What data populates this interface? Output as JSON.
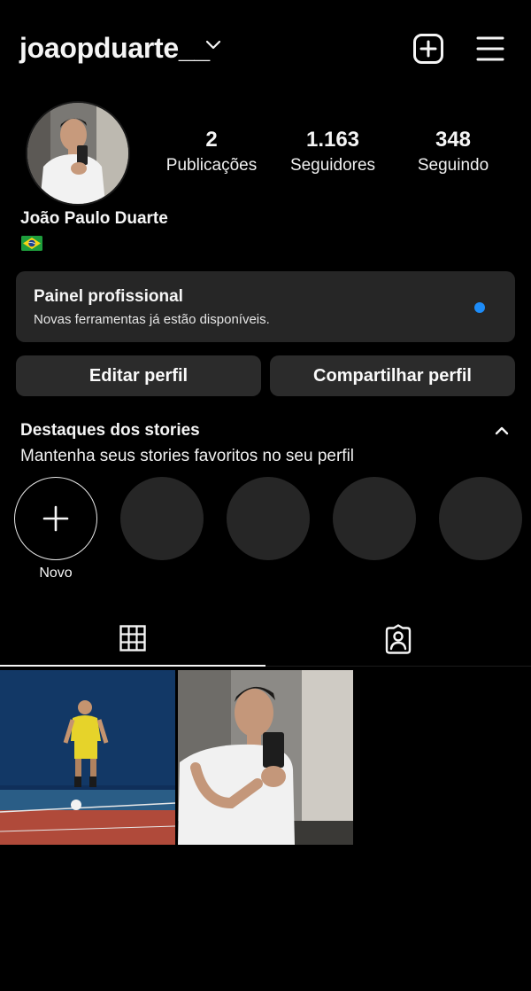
{
  "header": {
    "username": "joaopduarte__",
    "icons": {
      "switch": "chevron-down-icon",
      "new_post": "plus-square-icon",
      "menu": "hamburger-menu-icon"
    }
  },
  "profile": {
    "display_name": "João Paulo Duarte",
    "bio_flag": "brazil-flag-icon",
    "stats": [
      {
        "value": "2",
        "label": "Publicações"
      },
      {
        "value": "1.163",
        "label": "Seguidores"
      },
      {
        "value": "348",
        "label": "Seguindo"
      }
    ]
  },
  "pro_panel": {
    "title": "Painel profissional",
    "subtitle": "Novas ferramentas já estão disponíveis.",
    "dot_color": "#1d8cf8"
  },
  "actions": {
    "edit_label": "Editar perfil",
    "share_label": "Compartilhar perfil"
  },
  "highlights": {
    "title": "Destaques dos stories",
    "subtitle": "Mantenha seus stories favoritos no seu perfil",
    "new_label": "Novo",
    "empty_slots": 4
  },
  "tabs": [
    {
      "name": "grid",
      "icon": "grid-icon",
      "active": true
    },
    {
      "name": "tagged",
      "icon": "tagged-person-icon",
      "active": false
    }
  ],
  "posts_count_shown": 2,
  "colors": {
    "background": "#000000",
    "surface": "#262626",
    "button": "#2b2b2b",
    "accent_blue": "#1d8cf8"
  }
}
